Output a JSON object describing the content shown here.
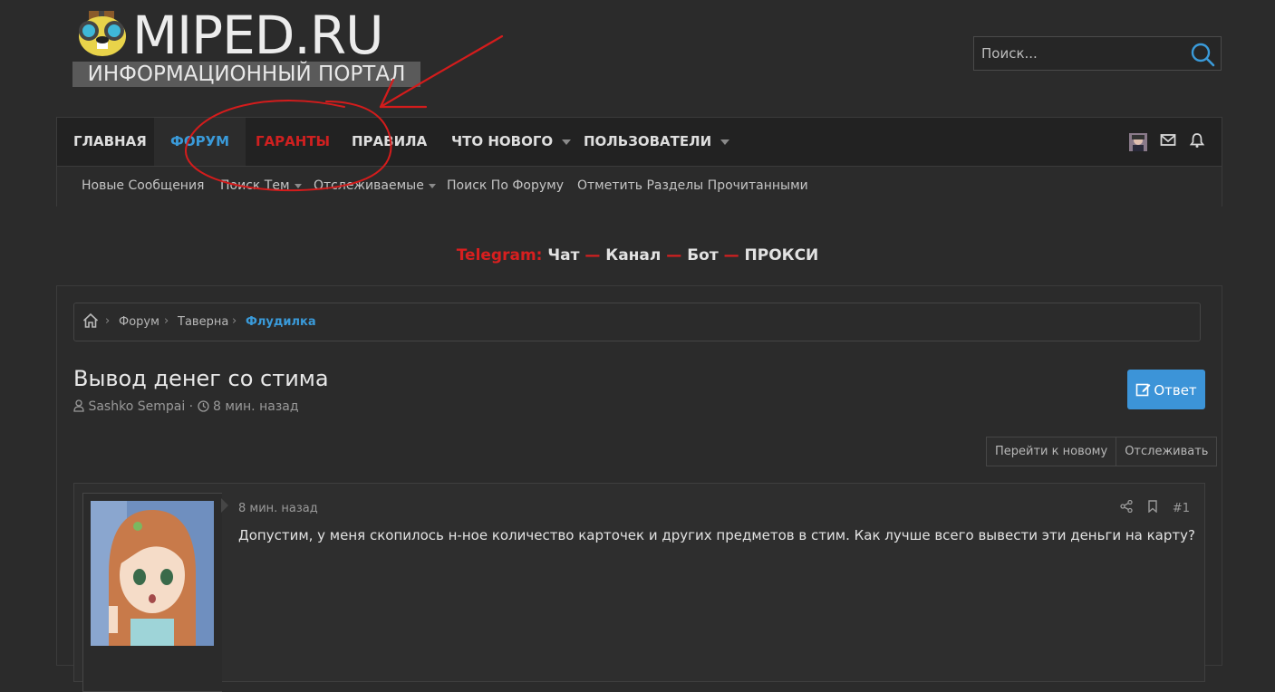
{
  "header": {
    "logo_title": "MIPED.RU",
    "logo_subtitle": "ИНФОРМАЦИОННЫЙ ПОРТАЛ",
    "search_placeholder": "Поиск..."
  },
  "nav": {
    "items": [
      {
        "label": "Главная"
      },
      {
        "label": "Форум"
      },
      {
        "label": "Гаранты"
      },
      {
        "label": "Правила"
      },
      {
        "label": "Что нового"
      },
      {
        "label": "Пользователи"
      }
    ]
  },
  "subnav": {
    "items": [
      {
        "label": "Новые Сообщения"
      },
      {
        "label": "Поиск Тем"
      },
      {
        "label": "Отслеживаемые"
      },
      {
        "label": "Поиск По Форуму"
      },
      {
        "label": "Отметить Разделы Прочитанными"
      }
    ]
  },
  "telegram": {
    "prefix": "Telegram:",
    "chat": "Чат",
    "channel": "Канал",
    "bot": "Бот",
    "proxy": "ПРОКСИ",
    "dash": "—"
  },
  "breadcrumb": {
    "items": [
      "Форум",
      "Таверна",
      "Флудилка"
    ]
  },
  "thread": {
    "title": "Вывод денег со стима",
    "author": "Sashko Sempai",
    "separator": "·",
    "time": "8 мин. назад",
    "reply_label": "Ответ",
    "go_new_label": "Перейти к новому",
    "watch_label": "Отслеживать"
  },
  "post": {
    "time": "8 мин. назад",
    "number": "#1",
    "body": "Допустим, у меня скопилось н-ное количество карточек и других предметов в стим. Как лучше всего вывести эти деньги на карту?"
  },
  "colors": {
    "accent": "#3a9ad9",
    "red": "#cf2020",
    "background": "#2b2b2b"
  }
}
